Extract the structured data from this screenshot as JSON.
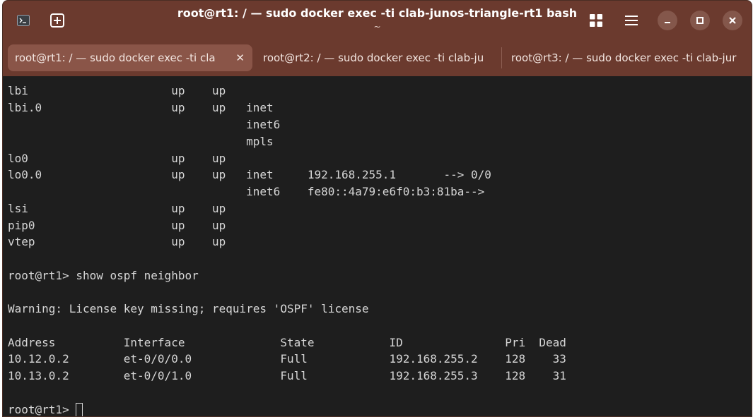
{
  "window": {
    "title": "root@rt1: / — sudo docker exec -ti clab-junos-triangle-rt1 bash",
    "subtitle": "~",
    "icons": [
      "terminal-icon",
      "new-tab-icon",
      "grid-view-icon",
      "menu-icon",
      "minimize-icon",
      "maximize-icon",
      "close-icon"
    ]
  },
  "tabs": [
    {
      "label": "root@rt1: / — sudo docker exec -ti cla",
      "active": true,
      "close_glyph": "✕"
    },
    {
      "label": "root@rt2: / — sudo docker exec -ti clab-ju",
      "active": false
    },
    {
      "label": "root@rt3: / — sudo docker exec -ti clab-jur",
      "active": false
    }
  ],
  "terminal": {
    "lines": [
      "lbi                     up    up",
      "lbi.0                   up    up   inet",
      "                                   inet6",
      "                                   mpls",
      "lo0                     up    up",
      "lo0.0                   up    up   inet     192.168.255.1       --> 0/0",
      "                                   inet6    fe80::4a79:e6f0:b3:81ba-->",
      "lsi                     up    up",
      "pip0                    up    up",
      "vtep                    up    up",
      "",
      "root@rt1> show ospf neighbor",
      "",
      "Warning: License key missing; requires 'OSPF' license",
      "",
      "Address          Interface              State           ID               Pri  Dead",
      "10.12.0.2        et-0/0/0.0             Full            192.168.255.2    128    33",
      "10.13.0.2        et-0/0/1.0             Full            192.168.255.3    128    31",
      ""
    ],
    "prompt": "root@rt1> "
  },
  "colors": {
    "titlebar": "#6b3a2e",
    "active_tab": "#8a5548",
    "terminal_bg": "#1e1e1e",
    "terminal_fg": "#d6d6d6"
  }
}
